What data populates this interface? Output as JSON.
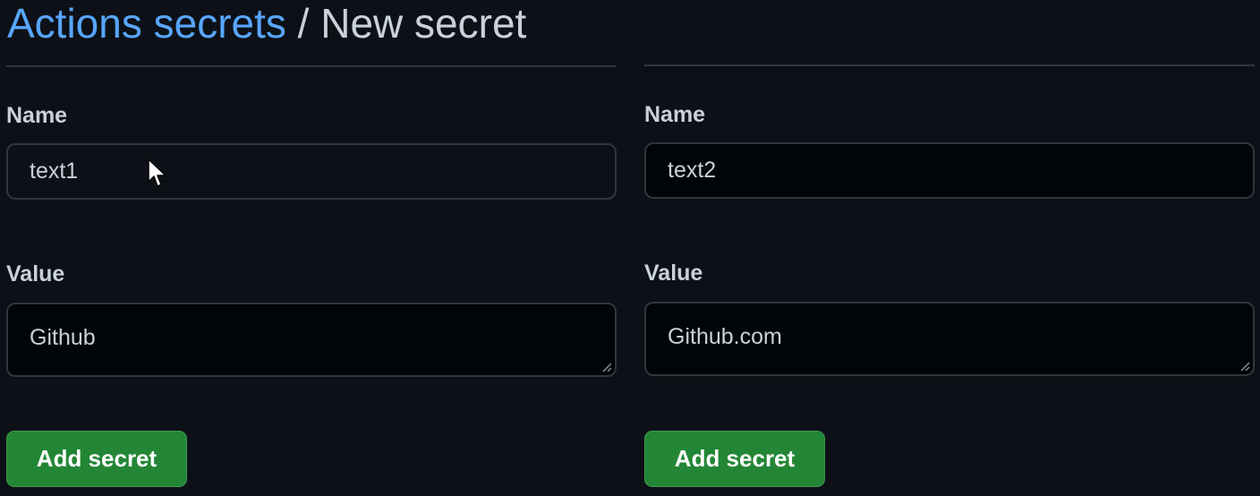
{
  "header": {
    "breadcrumb_link": "Actions secrets",
    "separator": " / ",
    "current_page": "New secret"
  },
  "forms": [
    {
      "name_label": "Name",
      "name_value": "text1",
      "value_label": "Value",
      "value_value": "Github",
      "submit_label": "Add secret"
    },
    {
      "name_label": "Name",
      "name_value": "text2",
      "value_label": "Value",
      "value_value": "Github.com",
      "submit_label": "Add secret"
    }
  ],
  "icons": {
    "pointer": "mouse-pointer-icon",
    "grip": "resize-grip-icon"
  },
  "colors": {
    "background": "#0d1117",
    "link": "#58a6ff",
    "text": "#c9d1d9",
    "border": "#30363d",
    "button": "#238636"
  }
}
